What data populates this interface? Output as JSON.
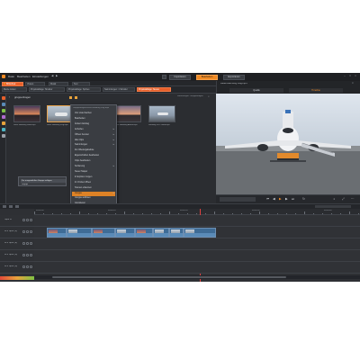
{
  "app": {
    "menu": [
      "Datei",
      "Bearbeiten",
      "Einstellungen"
    ],
    "modes": [
      {
        "label": "Importieren",
        "active": false
      },
      {
        "label": "Bearbeiten",
        "active": true
      },
      {
        "label": "Exportieren",
        "active": false
      }
    ]
  },
  "library_tabs": {
    "row1": [
      "Bibliothek",
      "Videos",
      "Musik",
      "Text"
    ],
    "row2": [
      {
        "label": "Meine Listen",
        "active": false
      },
      {
        "label": "Projektablage: Struktur",
        "active": false
      },
      {
        "label": "Projektablage: Sprites",
        "active": false
      },
      {
        "label": "Sammlungen: 1 Struktur",
        "active": false
      },
      {
        "label": "Projektablage: Neues",
        "active": true
      }
    ],
    "folder_label": "gruppenbogen",
    "top_caption": "Sammlungen: Gruppenbogen"
  },
  "library_items": [
    {
      "caption": "Reise Hamburg Stadt.mp4",
      "kind": "sunset"
    },
    {
      "caption": "Reise Hamburg Flug.mp4",
      "kind": "plane"
    },
    {
      "caption": "Reise Hamburg Abend.mp4",
      "kind": "sunset"
    },
    {
      "caption": "Rundflug 2021 Stadt.mp4",
      "kind": "plane"
    }
  ],
  "context_menu": {
    "header": "Gruppenbogen/Reise Hamburg Flug.mp4",
    "items": [
      {
        "label": "Von Liste löschen",
        "submenu": false
      },
      {
        "label": "Bearbeiten",
        "submenu": false
      },
      {
        "label": "Ändern Eintrag",
        "submenu": false
      },
      {
        "label": "Anheften",
        "submenu": true
      },
      {
        "label": "Öffnen Fenster",
        "submenu": true
      },
      {
        "label": "Alle Clips",
        "submenu": true
      },
      {
        "label": "Sammlungen",
        "submenu": true
      },
      {
        "label": "Zur Wiedergabeliste",
        "submenu": false
      },
      {
        "label": "Eigenschaften bearbeiten",
        "submenu": false
      },
      {
        "label": "Clips bearbeiten",
        "submenu": false
      },
      {
        "label": "Sortierung",
        "submenu": true
      },
      {
        "label": "Neuer Stapel",
        "submenu": false
      },
      {
        "label": "In Explorer zeigen",
        "submenu": false
      },
      {
        "label": "Im Ordner öffnen",
        "submenu": false
      },
      {
        "label": "Szenen erkennen",
        "submenu": false
      },
      {
        "label": "Gruppe",
        "submenu": true,
        "highlight": true
      },
      {
        "label": "Gruppe auflösen",
        "submenu": false
      },
      {
        "label": "Gruppieren",
        "submenu": false
      },
      {
        "label": "Entfernen",
        "submenu": false
      },
      {
        "label": "Umbenennen",
        "submenu": false
      },
      {
        "label": "Verschieben",
        "submenu": true
      },
      {
        "label": "Kopieren",
        "submenu": false
      },
      {
        "label": "Einfügen",
        "submenu": false
      },
      {
        "label": "Vorgänge: Medienanalyse",
        "submenu": true
      },
      {
        "label": "Stabilisieren",
        "submenu": false
      },
      {
        "label": "Löschen",
        "submenu": false
      },
      {
        "label": "Informationen anzeigen",
        "submenu": false
      }
    ]
  },
  "submenu": {
    "items": [
      "Zur ausgewählten Gruppe zufügen",
      "Gruppe"
    ]
  },
  "preview": {
    "title": "Reise Hamburg Flug.mp4",
    "tabs": [
      "Quelle",
      "Timeline"
    ],
    "active_tab": "Timeline"
  },
  "timeline": {
    "tracks": [
      "Spur A",
      "A/V Spur (1)",
      "A/V Spur (2)",
      "A/V Spur (3)",
      "A/V Spur (4)"
    ],
    "ruler_labels": [
      "00:00:00",
      "00:00:10",
      "00:00:20",
      "00:00:30",
      "00:00:40"
    ]
  },
  "colors": {
    "accent": "#f08a24",
    "active_tab": "#e8602b",
    "clip": "#3f6c96",
    "playhead": "#e04040"
  }
}
